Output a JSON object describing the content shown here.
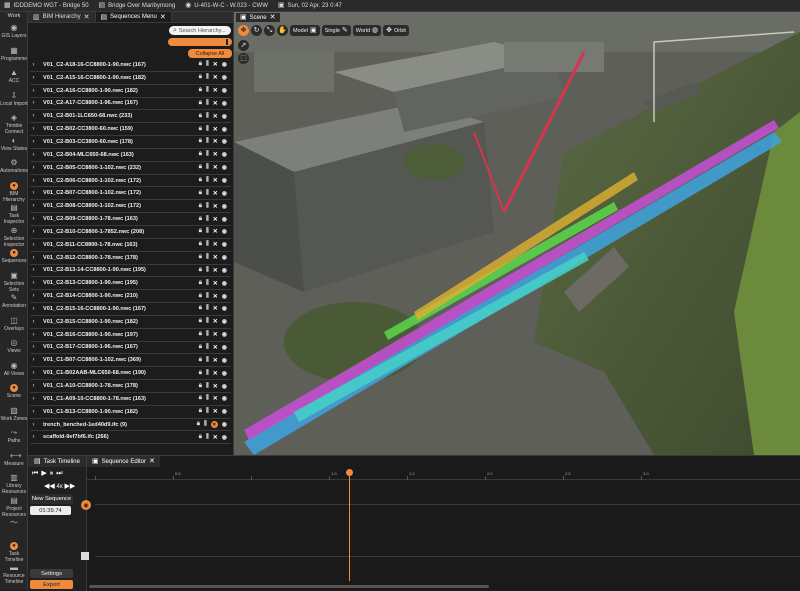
{
  "topbar": {
    "project": "IDDDEMO WGT - Bridge 50",
    "location": "Bridge Over Maribyrnong",
    "model": "U-401-W-C - W.023 - CWW",
    "datetime": "Sun, 02 Apr. 23  0:47"
  },
  "rail": {
    "work_label": "Work",
    "items": [
      {
        "icon": "gis-layers-icon",
        "glyph": "◉",
        "label": "GIS Layers"
      },
      {
        "icon": "programme-icon",
        "glyph": "▦",
        "label": "Programme"
      },
      {
        "icon": "acc-icon",
        "glyph": "▲",
        "label": "ACC"
      },
      {
        "icon": "local-import-icon",
        "glyph": "⇩",
        "label": "Local Import"
      },
      {
        "icon": "trimble-connect-icon",
        "glyph": "◈",
        "label": "Trimble Connect"
      },
      {
        "icon": "view-states-icon",
        "glyph": "◐",
        "label": "View States"
      },
      {
        "icon": "automations-icon",
        "glyph": "⚙",
        "label": "Automations"
      },
      {
        "icon": "bim-hierarchy-icon",
        "glyph": "●",
        "label": "BIM Hierarchy",
        "active": true
      },
      {
        "icon": "task-inspector-icon",
        "glyph": "▤",
        "label": "Task Inspector"
      },
      {
        "icon": "selection-inspector-icon",
        "glyph": "⊕",
        "label": "Selection Inspector"
      },
      {
        "icon": "sequences-icon",
        "glyph": "●",
        "label": "Sequences",
        "active": true
      },
      {
        "icon": "selection-sets-icon",
        "glyph": "▣",
        "label": "Selection Sets"
      },
      {
        "icon": "annotation-icon",
        "glyph": "✎",
        "label": "Annotation"
      },
      {
        "icon": "overlays-icon",
        "glyph": "◫",
        "label": "Overlays"
      },
      {
        "icon": "views-icon",
        "glyph": "◎",
        "label": "Views"
      },
      {
        "icon": "all-views-icon",
        "glyph": "◉",
        "label": "All Views"
      },
      {
        "icon": "scene-icon",
        "glyph": "●",
        "label": "Scene",
        "active": true
      },
      {
        "icon": "work-zones-icon",
        "glyph": "▧",
        "label": "Work Zones"
      },
      {
        "icon": "paths-icon",
        "glyph": "⤳",
        "label": "Paths"
      },
      {
        "icon": "measure-icon",
        "glyph": "⟷",
        "label": "Measure"
      },
      {
        "icon": "library-resources-icon",
        "glyph": "▥",
        "label": "Library Resources"
      },
      {
        "icon": "project-resources-icon",
        "glyph": "▤",
        "label": "Project Resources"
      },
      {
        "icon": "activity-icon",
        "glyph": "〜",
        "label": ""
      },
      {
        "icon": "task-timeline-icon",
        "glyph": "●",
        "label": "Task Timeline",
        "active": true
      },
      {
        "icon": "resource-timeline-icon",
        "glyph": "▬",
        "label": "Resource Timeline"
      }
    ]
  },
  "panel": {
    "tabs": [
      "BIM Hierarchy",
      "Sequences Menu"
    ],
    "search_placeholder": "Search Hierarchy...",
    "collapse_all": "Collapse All",
    "rows": [
      "V01_C2-A18-16-CC8800-1-90.nwc (167)",
      "V01_C2-A15-16-CC8800-1-90.nwc (182)",
      "V01_C2-A16-CC8800-1-90.nwc (182)",
      "V01_C2-A17-CC8800-1-96.nwc (167)",
      "V01_C2-B01-1LC650-68.nwc (233)",
      "V01_C2-B02-CC3800-60.nwc (159)",
      "V01_C2-B03-CC3800-60.nwc (178)",
      "V01_C2-B04-MLC650-68.nwc (163)",
      "V01_C2-B05-CC8800-1-102.nwc (232)",
      "V01_C2-B06-CC8800-1-102.nwc (172)",
      "V01_C2-B07-CC8800-1-102.nwc (172)",
      "V01_C2-B08-CC8800-1-102.nwc (172)",
      "V01_C2-B09-CC8800-1-78.nwc (163)",
      "V01_C2-B10-CC8800-1-7852.nwc (208)",
      "V01_C2-B11-CC8800-1-78.nwc (163)",
      "V01_C2-B12-CC8800-1-78.nwc (178)",
      "V01_C2-B13-14-CC8800-1-90.nwc (195)",
      "V01_C2-B13-CC8800-1-90.nwc (195)",
      "V01_C2-B14-CC8800-1-90.nwc (210)",
      "V01_C2-B15-16-CC8800-1-90.nwc (167)",
      "V01_C2-B15-CC8800-1-90.nwc (182)",
      "V01_C2-B16-CC8800-1-90.nwc (197)",
      "V01_C2-B17-CC8800-1-96.nwc (167)",
      "V01_C1-B07-CC8800-1-102.nwc (369)",
      "V01_C1-B02AAB-MLC650-68.nwc (190)",
      "V01_C1-A10-CC8800-1-78.nwc (178)",
      "V01_C1-A09-10-CC8800-1-78.nwc (163)",
      "V01_C1-B13-CC8800-1-90.nwc (182)",
      "trench_benched-1ed40d9.ifc (9)",
      "scaffold-9ef7bf6.ifc (266)"
    ]
  },
  "scene": {
    "tab": "Scene",
    "tools": {
      "model": "Model",
      "single": "Single",
      "world": "World",
      "orbit": "Orbit"
    }
  },
  "timeline": {
    "tab": "Task Timeline",
    "speed": "4x",
    "new_sequence": "New Sequence",
    "time": "01:39.74",
    "settings": "Settings",
    "export": "Export"
  },
  "sequence_editor": {
    "tab": "Sequence Editor",
    "ticks": [
      "",
      "0.5",
      "",
      "1.0",
      "1.5",
      "2.0",
      "2.5",
      "3.0"
    ]
  },
  "colors": {
    "accent": "#f08a3c"
  }
}
